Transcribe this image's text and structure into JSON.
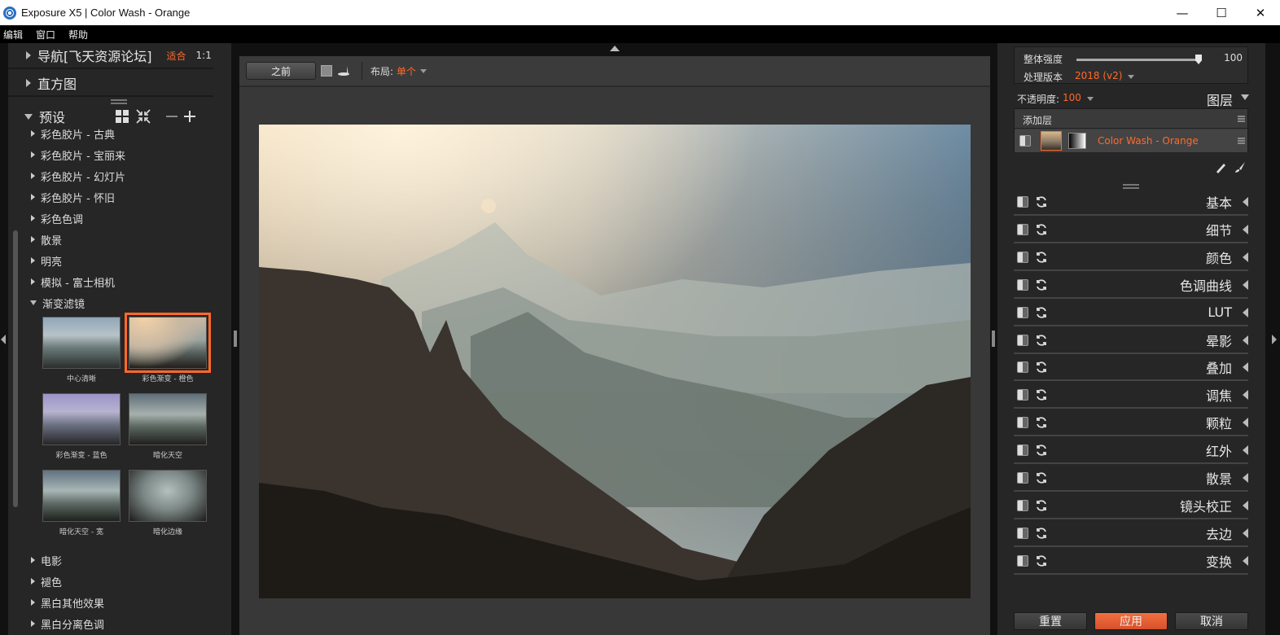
{
  "window": {
    "title": "Exposure X5 | Color Wash - Orange",
    "controls": [
      "—",
      "☐",
      "✕"
    ]
  },
  "menu": [
    "编辑",
    "窗口",
    "帮助"
  ],
  "left": {
    "navigator": {
      "label": "导航[飞天资源论坛]",
      "fit": "适合",
      "one_to_one": "1:1"
    },
    "histogram": {
      "label": "直方图"
    },
    "presets": {
      "label": "预设",
      "items_before": [
        "彩色胶片 - 古典",
        "彩色胶片 - 宝丽来",
        "彩色胶片 - 幻灯片",
        "彩色胶片 - 怀旧",
        "彩色色调",
        "散景",
        "明亮",
        "模拟 - 富士相机"
      ],
      "expanded": "渐变滤镜",
      "thumbnails": [
        "中心清晰",
        "彩色渐变 - 橙色",
        "彩色渐变 - 蓝色",
        "暗化天空",
        "暗化天空 - 宽",
        "暗化边缘"
      ],
      "items_after": [
        "电影",
        "褪色",
        "黑白其他效果",
        "黑白分离色调"
      ]
    }
  },
  "center": {
    "before_button": "之前",
    "layout_label": "布局:",
    "layout_value": "单个"
  },
  "right": {
    "overall_strength": {
      "label": "整体强度",
      "value": "100",
      "fraction": 1.0
    },
    "process_version": {
      "label": "处理版本",
      "value": "2018 (v2)"
    },
    "opacity": {
      "label": "不透明度:",
      "value": "100"
    },
    "layers_label": "图层",
    "add_layer": "添加层",
    "layer_name": "Color Wash - Orange",
    "panels": [
      "基本",
      "细节",
      "颜色",
      "色调曲线",
      "LUT",
      "晕影",
      "叠加",
      "调焦",
      "颗粒",
      "红外",
      "散景",
      "镜头校正",
      "去边",
      "变换"
    ],
    "buttons": {
      "reset": "重置",
      "apply": "应用",
      "cancel": "取消"
    }
  },
  "colors": {
    "accent": "#ff6a2a",
    "panel_bg": "#262626",
    "canvas_bg": "#383838"
  }
}
